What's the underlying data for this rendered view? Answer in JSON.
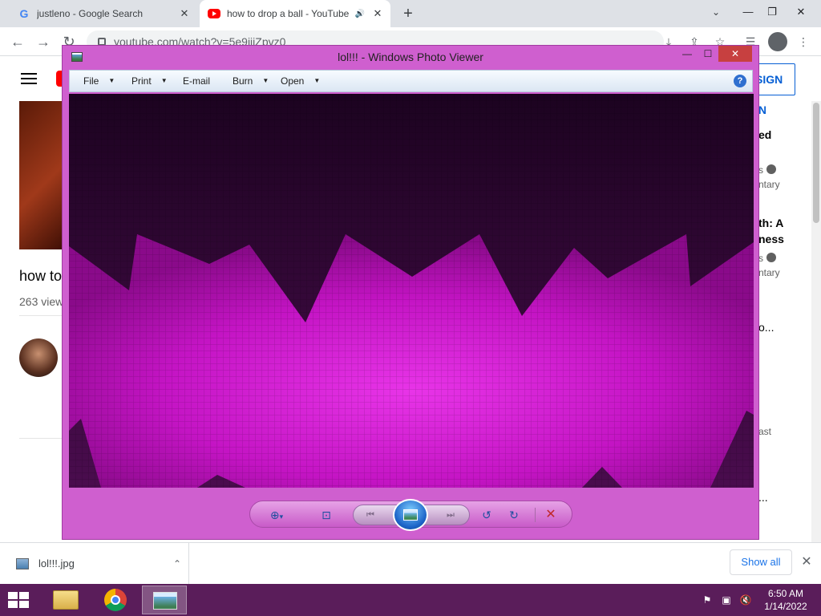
{
  "browser": {
    "tabs": [
      {
        "title": "justleno - Google Search",
        "favicon": "google-g-icon",
        "active": false
      },
      {
        "title": "how to drop a ball - YouTube",
        "favicon": "youtube-icon",
        "active": true,
        "audio": "speaker-icon"
      }
    ],
    "newtab_symbol": "+",
    "tab_search_symbol": "⌄",
    "window_controls": {
      "minimize": "—",
      "maximize": "❐",
      "close": "✕"
    },
    "url": "youtube.com/watch?v=5e9iiiZpvz0",
    "nav": {
      "back": "←",
      "forward": "→",
      "reload": "↻"
    }
  },
  "youtube": {
    "video_title": "how to",
    "views": "263 view",
    "sign_in": "SIGN IN",
    "sidebar_snippets": [
      {
        "text": "ed",
        "style": "bold"
      },
      {
        "text": "s",
        "style": "meta",
        "verified": true
      },
      {
        "text": "ntary",
        "style": "meta"
      },
      {
        "text": "th: A",
        "style": "bold"
      },
      {
        "text": "ness",
        "style": "bold"
      },
      {
        "text": "s",
        "style": "meta",
        "verified": true
      },
      {
        "text": "ntary",
        "style": "meta"
      },
      {
        "text": "o...",
        "style": "normal"
      },
      {
        "text": "ast",
        "style": "meta"
      },
      {
        "text": "...",
        "style": "normal"
      }
    ]
  },
  "downloads": {
    "file_name": "lol!!!.jpg",
    "show_all": "Show all",
    "close": "✕",
    "chevron": "⌃"
  },
  "photo_viewer": {
    "title": "lol!!! - Windows Photo Viewer",
    "window_controls": {
      "minimize": "—",
      "maximize": "☐",
      "close": "✕"
    },
    "menu": [
      {
        "label": "File",
        "has_dropdown": true
      },
      {
        "label": "Print",
        "has_dropdown": true
      },
      {
        "label": "E-mail",
        "has_dropdown": false
      },
      {
        "label": "Burn",
        "has_dropdown": true
      },
      {
        "label": "Open",
        "has_dropdown": true
      }
    ],
    "help": "?",
    "controls": {
      "zoom": "⊕",
      "zoom_arrow": "▾",
      "actual_size": "⊡",
      "previous": "⏮",
      "next": "⏭",
      "rotate_ccw": "↺",
      "rotate_cw": "↻",
      "delete": "✕"
    },
    "image_colors": {
      "dark": "#2c0530",
      "magenta": "#c414c4",
      "highlight": "#e030e0"
    }
  },
  "taskbar": {
    "time": "6:50 AM",
    "date": "1/14/2022",
    "apps": [
      "file-explorer-icon",
      "chrome-icon",
      "photo-viewer-icon"
    ],
    "tray": [
      "action-center-flag-icon",
      "network-icon",
      "volume-muted-icon"
    ]
  }
}
